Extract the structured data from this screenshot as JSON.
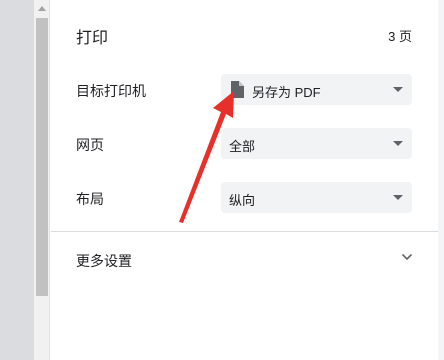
{
  "header": {
    "title": "打印",
    "page_count": "3 页"
  },
  "rows": [
    {
      "label": "目标打印机",
      "value": "另存为 PDF",
      "icon": "document-icon"
    },
    {
      "label": "网页",
      "value": "全部"
    },
    {
      "label": "布局",
      "value": "纵向"
    }
  ],
  "more_settings": {
    "label": "更多设置"
  },
  "colors": {
    "annotation_arrow": "#e8302a",
    "select_background": "#f1f3f4",
    "scroll_thumb": "#c1c1c1"
  }
}
